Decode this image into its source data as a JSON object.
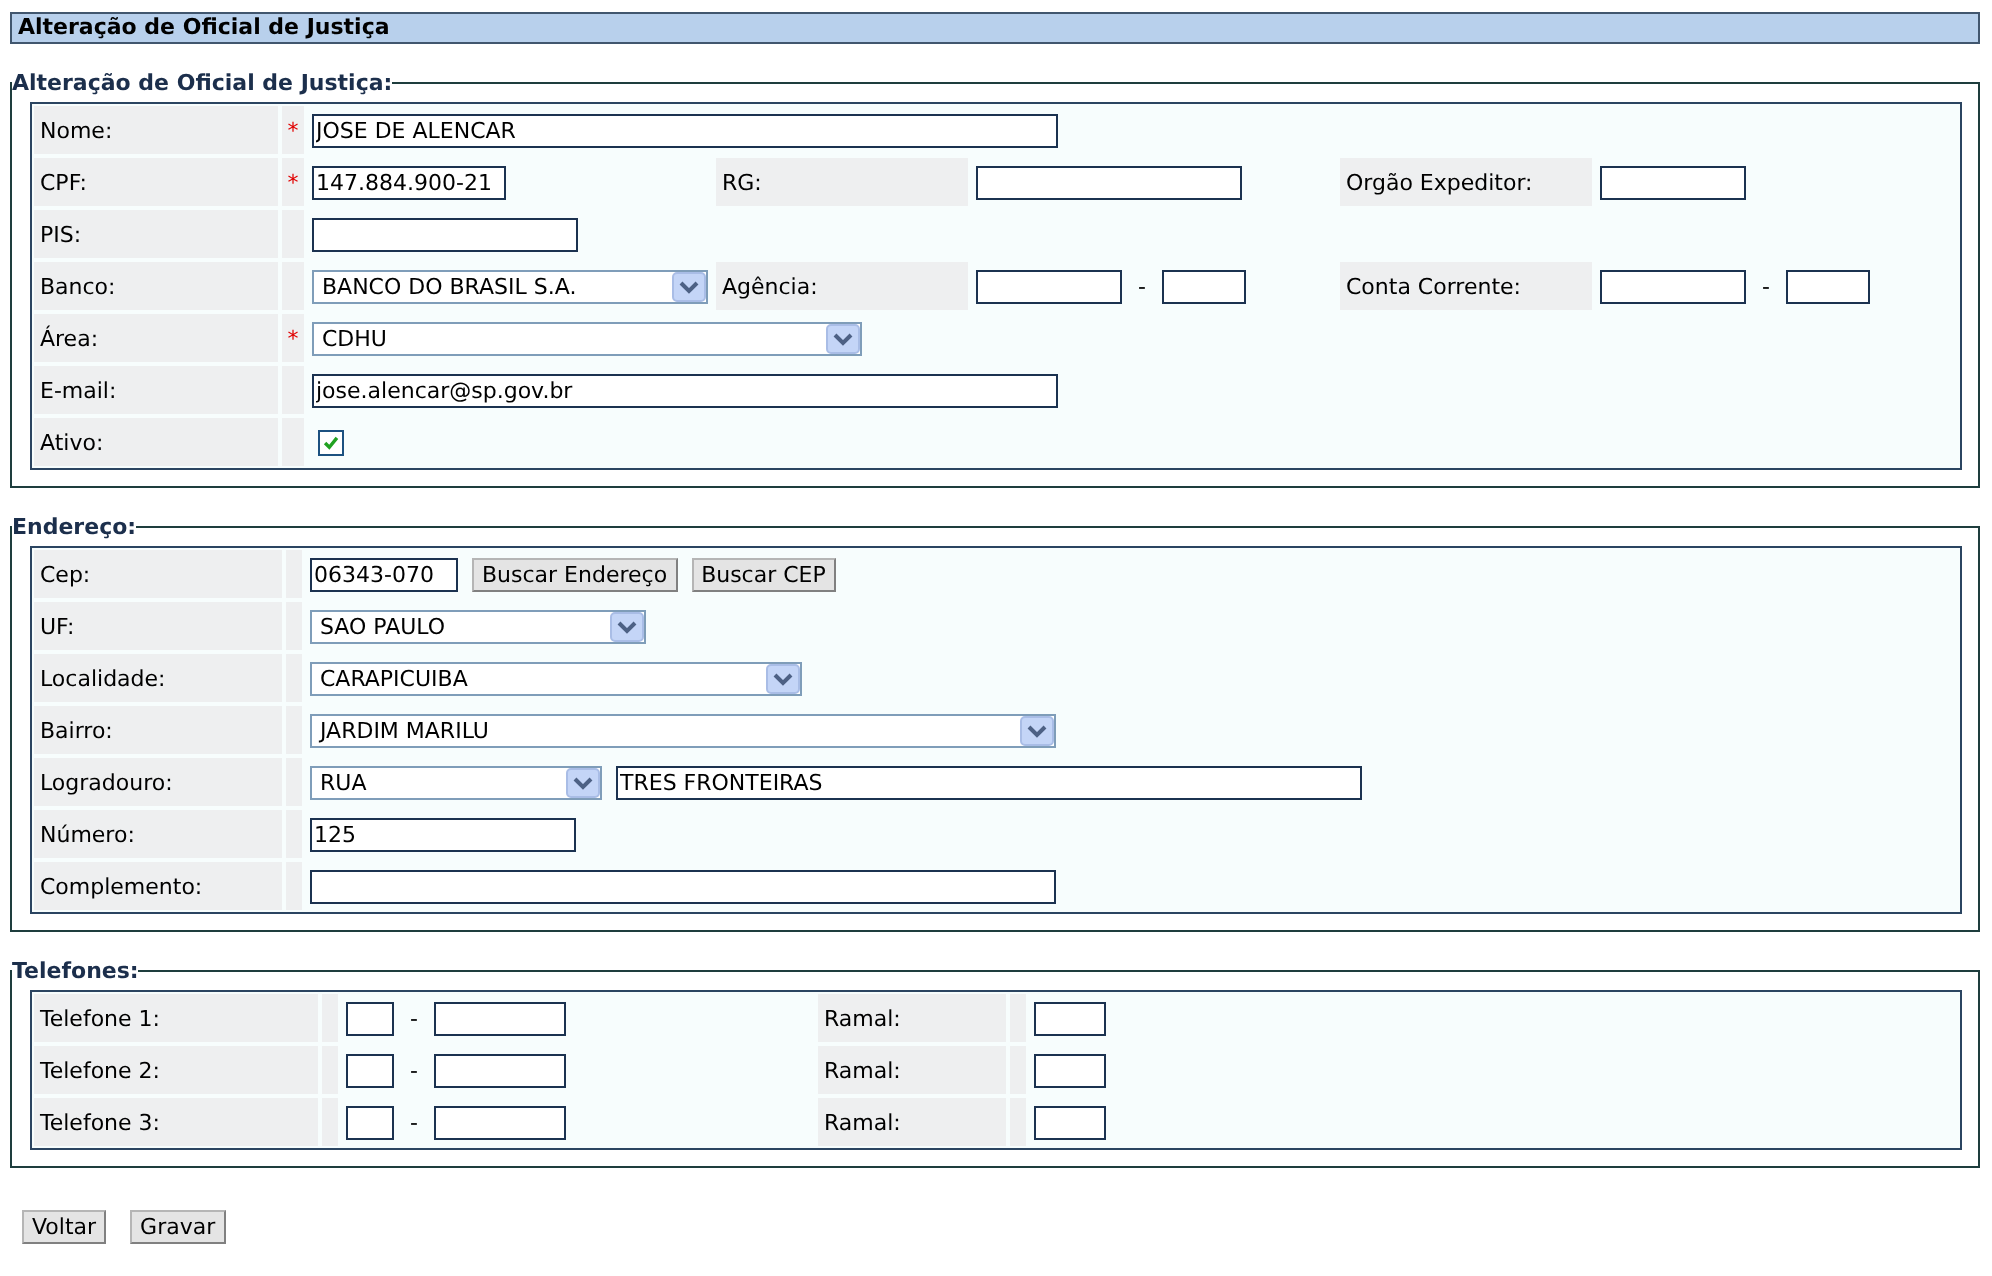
{
  "header": {
    "title": "Alteração de Oficial de Justiça"
  },
  "oficial": {
    "legend": "Alteração de Oficial de Justiça:",
    "nome": {
      "label": "Nome:",
      "required_mark": "*",
      "value": "JOSE DE ALENCAR"
    },
    "cpf": {
      "label": "CPF:",
      "required_mark": "*",
      "value": "147.884.900-21"
    },
    "rg": {
      "label": "RG:"
    },
    "orgao_expeditor": {
      "label": "Orgão Expeditor:"
    },
    "pis": {
      "label": "PIS:"
    },
    "banco": {
      "label": "Banco:",
      "value": "BANCO DO BRASIL S.A."
    },
    "agencia": {
      "label": "Agência:",
      "separator": "-"
    },
    "conta_corrente": {
      "label": "Conta Corrente:",
      "separator": "-"
    },
    "area": {
      "label": "Área:",
      "required_mark": "*",
      "value": "CDHU"
    },
    "email": {
      "label": "E-mail:",
      "value": "jose.alencar@sp.gov.br"
    },
    "ativo": {
      "label": "Ativo:",
      "checked": true
    }
  },
  "endereco": {
    "legend": "Endereço:",
    "cep": {
      "label": "Cep:",
      "value": "06343-070",
      "buttons": [
        "Buscar Endereço",
        "Buscar CEP"
      ]
    },
    "uf": {
      "label": "UF:",
      "value": "SAO PAULO"
    },
    "localidade": {
      "label": "Localidade:",
      "value": "CARAPICUIBA"
    },
    "bairro": {
      "label": "Bairro:",
      "value": "JARDIM MARILU"
    },
    "logradouro": {
      "label": "Logradouro:",
      "type": "RUA",
      "value": "TRES FRONTEIRAS"
    },
    "numero": {
      "label": "Número:",
      "value": "125"
    },
    "complemento": {
      "label": "Complemento:"
    }
  },
  "telefones": {
    "legend": "Telefones:",
    "rows": [
      {
        "label": "Telefone 1:",
        "separator": "-",
        "ramal_label": "Ramal:"
      },
      {
        "label": "Telefone 2:",
        "separator": "-",
        "ramal_label": "Ramal:"
      },
      {
        "label": "Telefone 3:",
        "separator": "-",
        "ramal_label": "Ramal:"
      }
    ]
  },
  "buttons": [
    "Voltar",
    "Gravar"
  ]
}
